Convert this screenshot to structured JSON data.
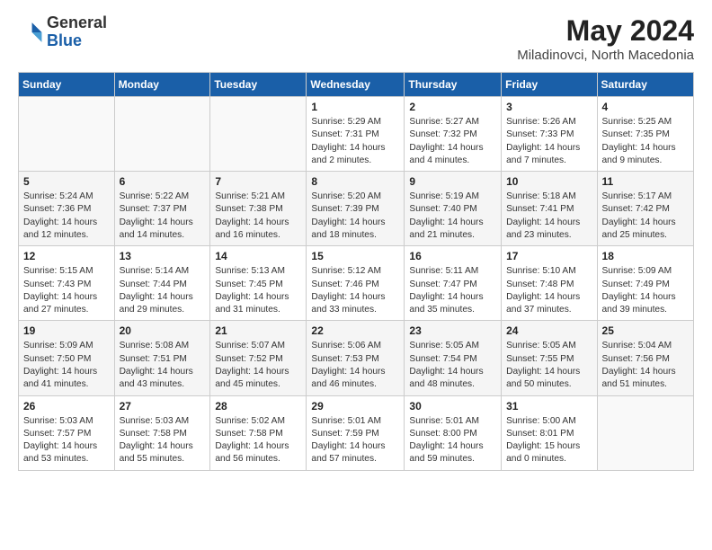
{
  "header": {
    "logo_general": "General",
    "logo_blue": "Blue",
    "month_year": "May 2024",
    "location": "Miladinovci, North Macedonia"
  },
  "days_of_week": [
    "Sunday",
    "Monday",
    "Tuesday",
    "Wednesday",
    "Thursday",
    "Friday",
    "Saturday"
  ],
  "weeks": [
    [
      {
        "day": "",
        "info": ""
      },
      {
        "day": "",
        "info": ""
      },
      {
        "day": "",
        "info": ""
      },
      {
        "day": "1",
        "info": "Sunrise: 5:29 AM\nSunset: 7:31 PM\nDaylight: 14 hours\nand 2 minutes."
      },
      {
        "day": "2",
        "info": "Sunrise: 5:27 AM\nSunset: 7:32 PM\nDaylight: 14 hours\nand 4 minutes."
      },
      {
        "day": "3",
        "info": "Sunrise: 5:26 AM\nSunset: 7:33 PM\nDaylight: 14 hours\nand 7 minutes."
      },
      {
        "day": "4",
        "info": "Sunrise: 5:25 AM\nSunset: 7:35 PM\nDaylight: 14 hours\nand 9 minutes."
      }
    ],
    [
      {
        "day": "5",
        "info": "Sunrise: 5:24 AM\nSunset: 7:36 PM\nDaylight: 14 hours\nand 12 minutes."
      },
      {
        "day": "6",
        "info": "Sunrise: 5:22 AM\nSunset: 7:37 PM\nDaylight: 14 hours\nand 14 minutes."
      },
      {
        "day": "7",
        "info": "Sunrise: 5:21 AM\nSunset: 7:38 PM\nDaylight: 14 hours\nand 16 minutes."
      },
      {
        "day": "8",
        "info": "Sunrise: 5:20 AM\nSunset: 7:39 PM\nDaylight: 14 hours\nand 18 minutes."
      },
      {
        "day": "9",
        "info": "Sunrise: 5:19 AM\nSunset: 7:40 PM\nDaylight: 14 hours\nand 21 minutes."
      },
      {
        "day": "10",
        "info": "Sunrise: 5:18 AM\nSunset: 7:41 PM\nDaylight: 14 hours\nand 23 minutes."
      },
      {
        "day": "11",
        "info": "Sunrise: 5:17 AM\nSunset: 7:42 PM\nDaylight: 14 hours\nand 25 minutes."
      }
    ],
    [
      {
        "day": "12",
        "info": "Sunrise: 5:15 AM\nSunset: 7:43 PM\nDaylight: 14 hours\nand 27 minutes."
      },
      {
        "day": "13",
        "info": "Sunrise: 5:14 AM\nSunset: 7:44 PM\nDaylight: 14 hours\nand 29 minutes."
      },
      {
        "day": "14",
        "info": "Sunrise: 5:13 AM\nSunset: 7:45 PM\nDaylight: 14 hours\nand 31 minutes."
      },
      {
        "day": "15",
        "info": "Sunrise: 5:12 AM\nSunset: 7:46 PM\nDaylight: 14 hours\nand 33 minutes."
      },
      {
        "day": "16",
        "info": "Sunrise: 5:11 AM\nSunset: 7:47 PM\nDaylight: 14 hours\nand 35 minutes."
      },
      {
        "day": "17",
        "info": "Sunrise: 5:10 AM\nSunset: 7:48 PM\nDaylight: 14 hours\nand 37 minutes."
      },
      {
        "day": "18",
        "info": "Sunrise: 5:09 AM\nSunset: 7:49 PM\nDaylight: 14 hours\nand 39 minutes."
      }
    ],
    [
      {
        "day": "19",
        "info": "Sunrise: 5:09 AM\nSunset: 7:50 PM\nDaylight: 14 hours\nand 41 minutes."
      },
      {
        "day": "20",
        "info": "Sunrise: 5:08 AM\nSunset: 7:51 PM\nDaylight: 14 hours\nand 43 minutes."
      },
      {
        "day": "21",
        "info": "Sunrise: 5:07 AM\nSunset: 7:52 PM\nDaylight: 14 hours\nand 45 minutes."
      },
      {
        "day": "22",
        "info": "Sunrise: 5:06 AM\nSunset: 7:53 PM\nDaylight: 14 hours\nand 46 minutes."
      },
      {
        "day": "23",
        "info": "Sunrise: 5:05 AM\nSunset: 7:54 PM\nDaylight: 14 hours\nand 48 minutes."
      },
      {
        "day": "24",
        "info": "Sunrise: 5:05 AM\nSunset: 7:55 PM\nDaylight: 14 hours\nand 50 minutes."
      },
      {
        "day": "25",
        "info": "Sunrise: 5:04 AM\nSunset: 7:56 PM\nDaylight: 14 hours\nand 51 minutes."
      }
    ],
    [
      {
        "day": "26",
        "info": "Sunrise: 5:03 AM\nSunset: 7:57 PM\nDaylight: 14 hours\nand 53 minutes."
      },
      {
        "day": "27",
        "info": "Sunrise: 5:03 AM\nSunset: 7:58 PM\nDaylight: 14 hours\nand 55 minutes."
      },
      {
        "day": "28",
        "info": "Sunrise: 5:02 AM\nSunset: 7:58 PM\nDaylight: 14 hours\nand 56 minutes."
      },
      {
        "day": "29",
        "info": "Sunrise: 5:01 AM\nSunset: 7:59 PM\nDaylight: 14 hours\nand 57 minutes."
      },
      {
        "day": "30",
        "info": "Sunrise: 5:01 AM\nSunset: 8:00 PM\nDaylight: 14 hours\nand 59 minutes."
      },
      {
        "day": "31",
        "info": "Sunrise: 5:00 AM\nSunset: 8:01 PM\nDaylight: 15 hours\nand 0 minutes."
      },
      {
        "day": "",
        "info": ""
      }
    ]
  ]
}
